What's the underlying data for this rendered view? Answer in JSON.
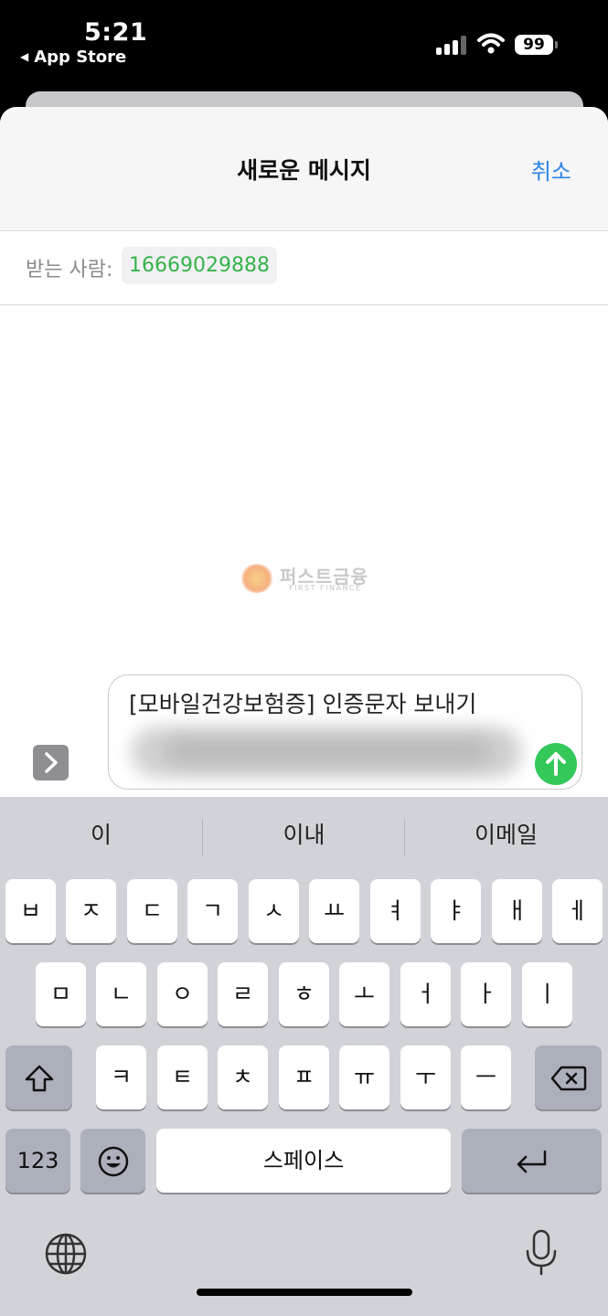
{
  "status_bar": {
    "time": "5:21",
    "back_app": "App Store",
    "battery": "99"
  },
  "header": {
    "title": "새로운 메시지",
    "cancel": "취소"
  },
  "recipient": {
    "label": "받는 사람:",
    "number": "16669029888"
  },
  "watermark": {
    "text": "퍼스트금융",
    "sub": "FIRST FINANCE"
  },
  "compose": {
    "text": "[모바일건강보험증] 인증문자 보내기"
  },
  "keyboard": {
    "suggestions": [
      "이",
      "이내",
      "이메일"
    ],
    "row1": [
      "ㅂ",
      "ㅈ",
      "ㄷ",
      "ㄱ",
      "ㅅ",
      "ㅛ",
      "ㅕ",
      "ㅑ",
      "ㅐ",
      "ㅔ"
    ],
    "row2": [
      "ㅁ",
      "ㄴ",
      "ㅇ",
      "ㄹ",
      "ㅎ",
      "ㅗ",
      "ㅓ",
      "ㅏ",
      "ㅣ"
    ],
    "row3": [
      "ㅋ",
      "ㅌ",
      "ㅊ",
      "ㅍ",
      "ㅠ",
      "ㅜ",
      "ㅡ"
    ],
    "numbers_label": "123",
    "space_label": "스페이스"
  }
}
